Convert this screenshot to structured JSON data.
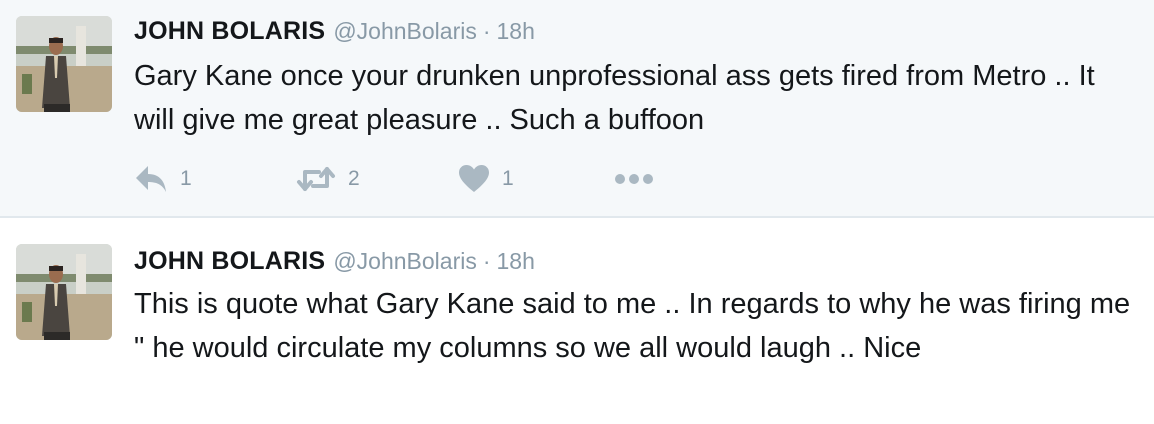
{
  "colors": {
    "text": "#14171a",
    "muted": "#8899a6",
    "action_icon": "#aab8c2",
    "highlight_bg": "#f5f8fa",
    "divider": "#e1e8ed"
  },
  "tweets": [
    {
      "display_name": "JOHN BOLARIS",
      "handle": "@JohnBolaris",
      "separator": "·",
      "time": "18h",
      "avatar_icon": "profile-photo",
      "text": "Gary Kane once your drunken unprofessional ass gets fired from Metro .. It will give me great pleasure .. Such a buffoon",
      "actions": {
        "reply_icon": "reply-icon",
        "reply_count": "1",
        "retweet_icon": "retweet-icon",
        "retweet_count": "2",
        "like_icon": "heart-icon",
        "like_count": "1",
        "more_icon": "more-dots-icon"
      }
    },
    {
      "display_name": "JOHN BOLARIS",
      "handle": "@JohnBolaris",
      "separator": "·",
      "time": "18h",
      "avatar_icon": "profile-photo",
      "text": "This is quote what Gary Kane said to me .. In regards to why he was firing me \" he would circulate my columns so we all would laugh .. Nice"
    }
  ]
}
